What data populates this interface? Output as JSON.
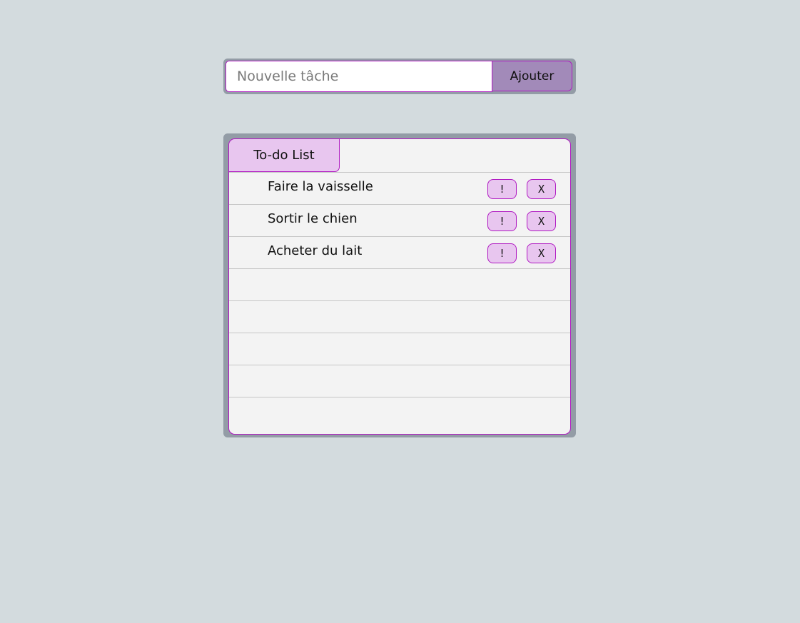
{
  "add_bar": {
    "input_value": "",
    "input_placeholder": "Nouvelle tâche",
    "button_label": "Ajouter"
  },
  "list": {
    "tab_title": "To-do List",
    "tasks": [
      {
        "label": "Faire la vaisselle",
        "important_label": "!",
        "delete_label": "X"
      },
      {
        "label": "Sortir le chien",
        "important_label": "!",
        "delete_label": "X"
      },
      {
        "label": "Acheter du lait",
        "important_label": "!",
        "delete_label": "X"
      }
    ],
    "empty_rows": 5
  },
  "colors": {
    "background": "#d3dbde",
    "frame": "#939ca6",
    "accent_border": "#b019c2",
    "tab_fill": "#e8c6ef",
    "add_button_fill": "#a28ab9",
    "panel_fill": "#f3f3f3"
  }
}
